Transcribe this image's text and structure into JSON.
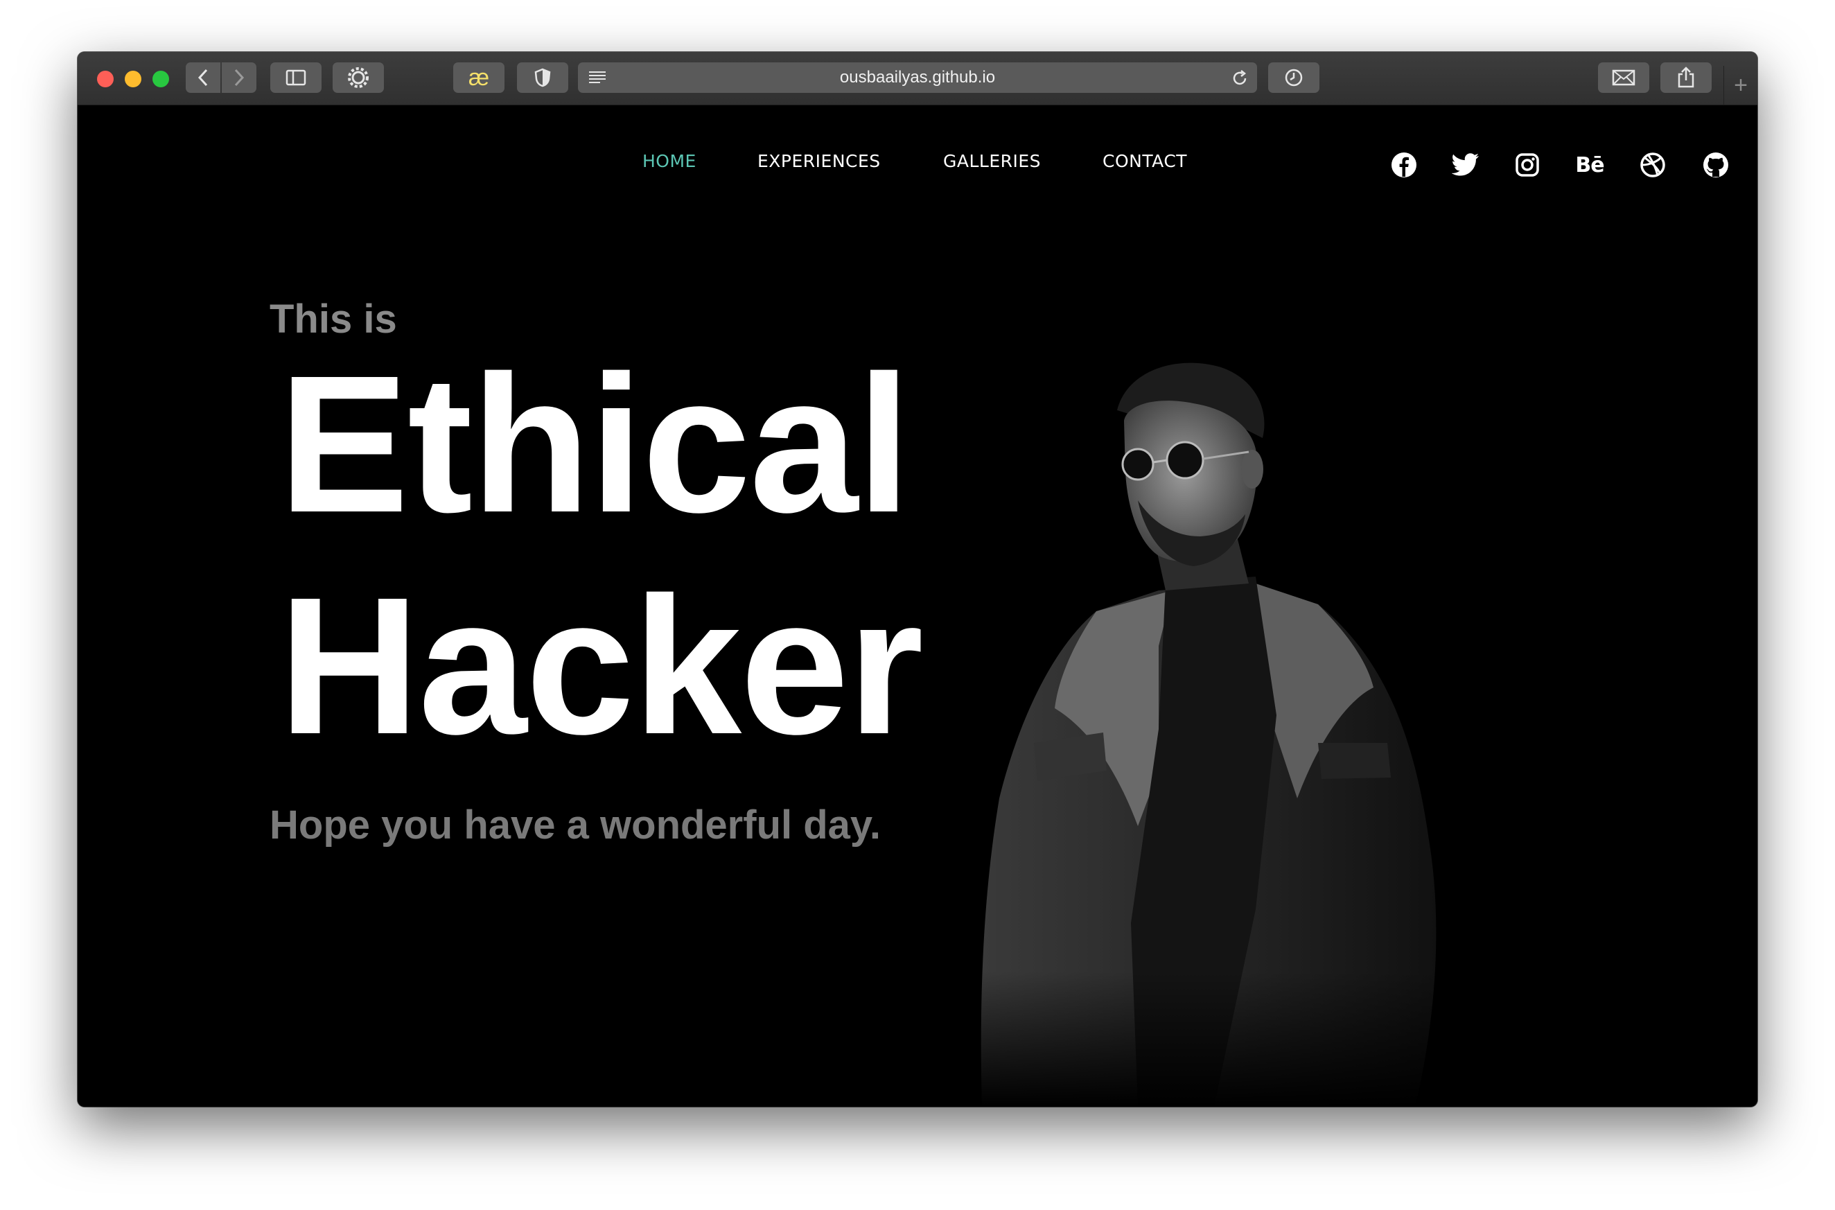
{
  "browser": {
    "url": "ousbaailyas.github.io",
    "extension_label": "æ",
    "new_tab_label": "+"
  },
  "nav": {
    "items": [
      {
        "label": "HOME",
        "active": true
      },
      {
        "label": "EXPERIENCES",
        "active": false
      },
      {
        "label": "GALLERIES",
        "active": false
      },
      {
        "label": "CONTACT",
        "active": false
      }
    ],
    "active_color": "#5cc6b4"
  },
  "social": {
    "icons": [
      "facebook-icon",
      "twitter-icon",
      "instagram-icon",
      "behance-icon",
      "dribbble-icon",
      "github-icon"
    ],
    "behance_text": "Bē"
  },
  "hero": {
    "intro": "This is",
    "title_line1": "Ethical",
    "title_line2": "Hacker",
    "tagline": "Hope you have a wonderful day."
  },
  "colors": {
    "background": "#000000",
    "title": "#ffffff",
    "muted": "#8a8a8a"
  }
}
